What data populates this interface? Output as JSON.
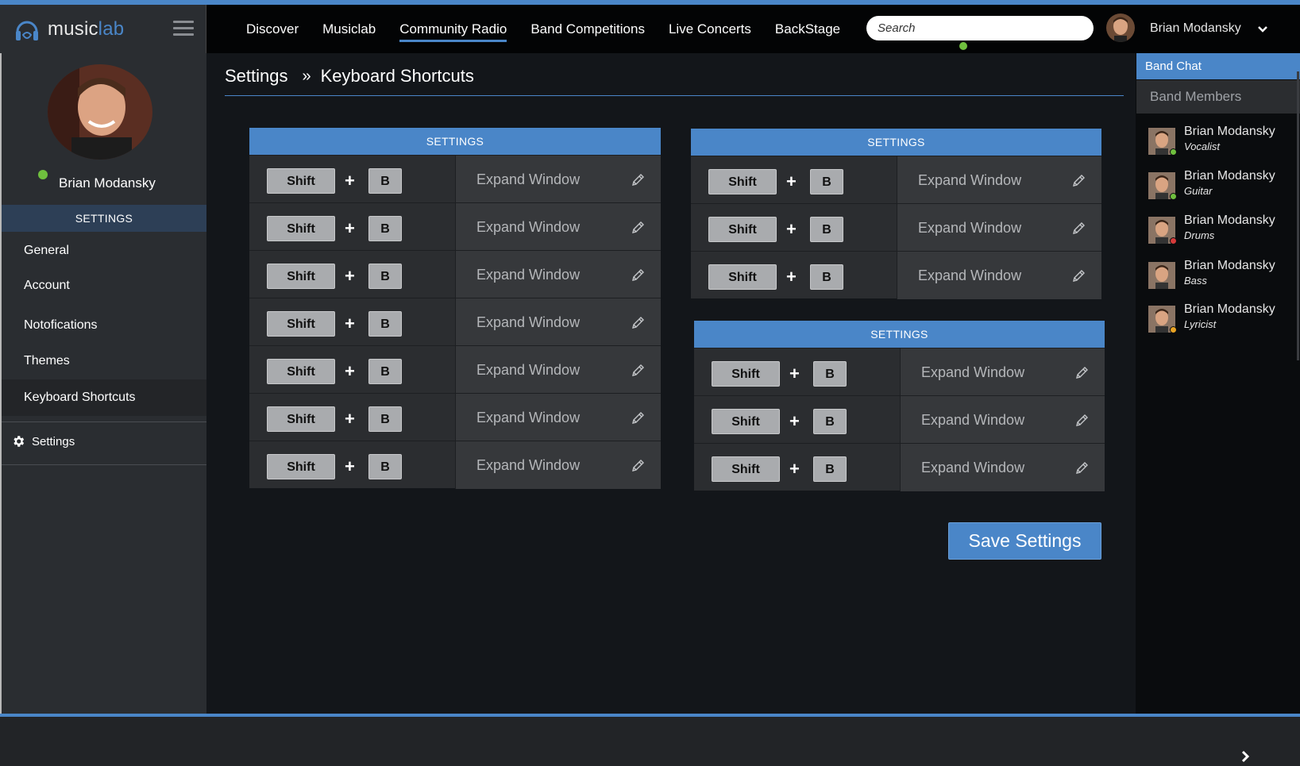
{
  "brand": {
    "name_part1": "music",
    "name_part2": "lab",
    "accent": "#4a86c8"
  },
  "nav": {
    "items": [
      {
        "label": "Discover",
        "active": false
      },
      {
        "label": "Musiclab",
        "active": false
      },
      {
        "label": "Community Radio",
        "active": true
      },
      {
        "label": "Band Competitions",
        "active": false
      },
      {
        "label": "Live Concerts",
        "active": false
      },
      {
        "label": "BackStage",
        "active": false
      }
    ]
  },
  "search": {
    "placeholder": "Search",
    "status_color": "#6fbf3e"
  },
  "user": {
    "name": "Brian Modansky",
    "status_color": "#6fbf3e"
  },
  "sidebar": {
    "section_title": "SETTINGS",
    "items": [
      {
        "label": "General",
        "active": false
      },
      {
        "label": "Account",
        "active": false
      },
      {
        "label": "Notofications",
        "active": false
      },
      {
        "label": "Themes",
        "active": false
      },
      {
        "label": "Keyboard Shortcuts",
        "active": true
      }
    ],
    "footer_link": "Settings"
  },
  "breadcrumb": {
    "root": "Settings",
    "separator": "»",
    "current": "Keyboard Shortcuts"
  },
  "panels": [
    {
      "title": "SETTINGS",
      "rows": [
        {
          "key1": "Shift",
          "plus": "+",
          "key2": "B",
          "action": "Expand Window"
        },
        {
          "key1": "Shift",
          "plus": "+",
          "key2": "B",
          "action": "Expand Window"
        },
        {
          "key1": "Shift",
          "plus": "+",
          "key2": "B",
          "action": "Expand Window"
        },
        {
          "key1": "Shift",
          "plus": "+",
          "key2": "B",
          "action": "Expand Window"
        },
        {
          "key1": "Shift",
          "plus": "+",
          "key2": "B",
          "action": "Expand Window"
        },
        {
          "key1": "Shift",
          "plus": "+",
          "key2": "B",
          "action": "Expand Window"
        },
        {
          "key1": "Shift",
          "plus": "+",
          "key2": "B",
          "action": "Expand Window"
        }
      ]
    },
    {
      "title": "SETTINGS",
      "rows": [
        {
          "key1": "Shift",
          "plus": "+",
          "key2": "B",
          "action": "Expand Window"
        },
        {
          "key1": "Shift",
          "plus": "+",
          "key2": "B",
          "action": "Expand Window"
        },
        {
          "key1": "Shift",
          "plus": "+",
          "key2": "B",
          "action": "Expand Window"
        }
      ]
    },
    {
      "title": "SETTINGS",
      "rows": [
        {
          "key1": "Shift",
          "plus": "+",
          "key2": "B",
          "action": "Expand Window"
        },
        {
          "key1": "Shift",
          "plus": "+",
          "key2": "B",
          "action": "Expand Window"
        },
        {
          "key1": "Shift",
          "plus": "+",
          "key2": "B",
          "action": "Expand Window"
        }
      ]
    }
  ],
  "save_button": "Save Settings",
  "right_panel": {
    "chat_title": "Band Chat",
    "members_title": "Band Members",
    "members": [
      {
        "name": "Brian Modansky",
        "role": "Vocalist",
        "status_color": "#6fbf3e"
      },
      {
        "name": "Brian Modansky",
        "role": "Guitar",
        "status_color": "#6fbf3e"
      },
      {
        "name": "Brian Modansky",
        "role": "Drums",
        "status_color": "#d63a3a"
      },
      {
        "name": "Brian Modansky",
        "role": "Bass",
        "status_color": ""
      },
      {
        "name": "Brian Modansky",
        "role": "Lyricist",
        "status_color": "#e8a323"
      }
    ]
  }
}
